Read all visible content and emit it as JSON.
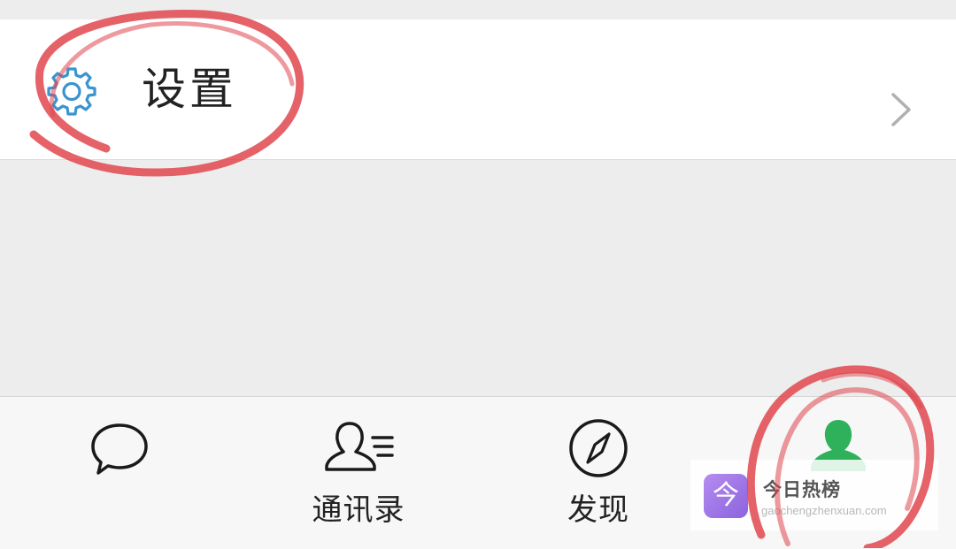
{
  "settings": {
    "label": "设置",
    "icon": "gear-icon",
    "chevron": "chevron-right-icon"
  },
  "tabbar": {
    "tabs": [
      {
        "key": "chats",
        "label": "",
        "icon": "chat-bubble-icon"
      },
      {
        "key": "contacts",
        "label": "通讯录",
        "icon": "contacts-icon"
      },
      {
        "key": "discover",
        "label": "发现",
        "icon": "compass-icon"
      },
      {
        "key": "me",
        "label": "",
        "icon": "person-icon",
        "active": true
      }
    ]
  },
  "watermark": {
    "logo_char": "今",
    "title": "今日热榜",
    "url": "gaochengzhenxuan.com"
  },
  "colors": {
    "accent": "#2fb15c",
    "gear": "#3a94cf",
    "annotation": "#e0464e"
  }
}
